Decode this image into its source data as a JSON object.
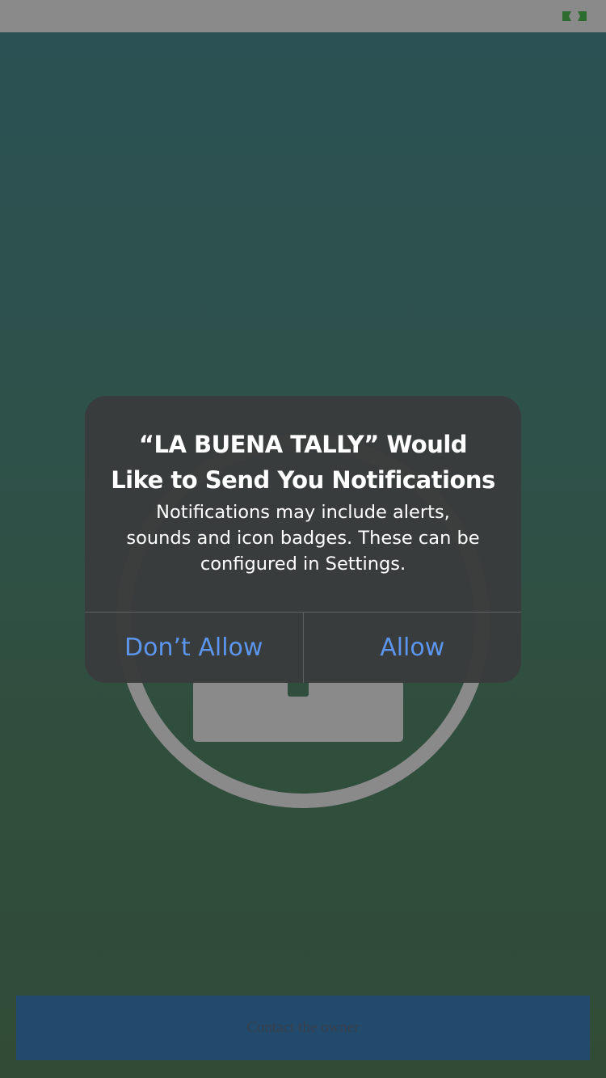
{
  "status_bar": {
    "battery_icon": "battery-icon",
    "battery_color": "#2e6b2e"
  },
  "app": {
    "logo_icon": "logo-ring-icon",
    "contact_button_label": "Contact the owner"
  },
  "alert": {
    "title_line1": "“LA BUENA TALLY” Would",
    "title_line2": "Like to Send You Notifications",
    "message_line1": "Notifications may include alerts,",
    "message_line2": "sounds and icon badges. These can be",
    "message_line3": "configured in Settings.",
    "dont_allow_label": "Don’t Allow",
    "allow_label": "Allow",
    "action_color": "#5c95ee"
  }
}
